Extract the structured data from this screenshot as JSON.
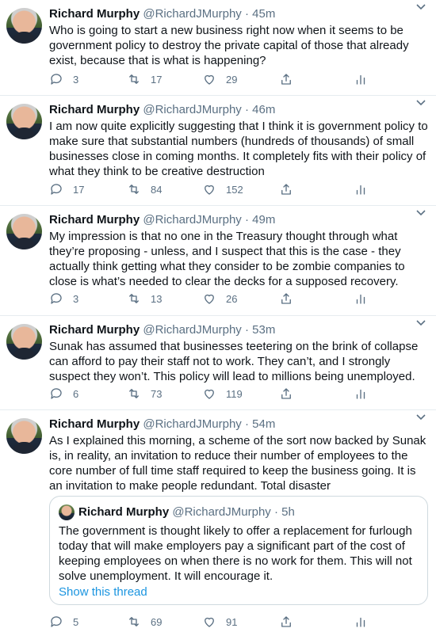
{
  "tweets": [
    {
      "name": "Richard Murphy",
      "handle": "@RichardJMurphy",
      "time": "45m",
      "text": "Who is going to start a new business right now when it seems to be government policy to destroy the private capital of those that already exist, because that is what is happening?",
      "replies": "3",
      "retweets": "17",
      "likes": "29"
    },
    {
      "name": "Richard Murphy",
      "handle": "@RichardJMurphy",
      "time": "46m",
      "text": "I am now quite explicitly suggesting that I think it is government policy to make sure that substantial numbers (hundreds of thousands) of small businesses close in coming months. It completely fits with their policy of what they think to be creative destruction",
      "replies": "17",
      "retweets": "84",
      "likes": "152"
    },
    {
      "name": "Richard Murphy",
      "handle": "@RichardJMurphy",
      "time": "49m",
      "text": "My impression is that no one in the Treasury thought through what they’re proposing - unless, and I suspect that this is the case - they actually think getting what they consider to be zombie companies to close is what’s needed to clear the decks for a supposed recovery.",
      "replies": "3",
      "retweets": "13",
      "likes": "26"
    },
    {
      "name": "Richard Murphy",
      "handle": "@RichardJMurphy",
      "time": "53m",
      "text": "Sunak has assumed that businesses teetering on the brink of collapse can afford to pay their staff not to work. They can’t, and I strongly suspect they won’t. This policy will lead to millions being unemployed.",
      "replies": "6",
      "retweets": "73",
      "likes": "119"
    },
    {
      "name": "Richard Murphy",
      "handle": "@RichardJMurphy",
      "time": "54m",
      "text": "As I explained this morning, a scheme of the sort now backed by Sunak is, in reality, an invitation to reduce their number of employees to the core number of full time staff required to keep the business going. It is an invitation to make people redundant. Total disaster",
      "replies": "5",
      "retweets": "69",
      "likes": "91",
      "quote": {
        "name": "Richard Murphy",
        "handle": "@RichardJMurphy",
        "time": "5h",
        "text": "The government is thought likely to offer a replacement for furlough today that will make employers pay a significant part of the cost of keeping employees on when there is no work for them. This will not solve unemployment. It will encourage it.",
        "link": "Show this thread"
      }
    }
  ],
  "separator": "·",
  "icons": [
    "more-icon",
    "reply-icon",
    "retweet-icon",
    "like-icon",
    "share-icon",
    "analytics-icon"
  ],
  "colors": {
    "secondary_text": "#5b7083",
    "link": "#1b95e0",
    "border": "#e6ecf0"
  }
}
